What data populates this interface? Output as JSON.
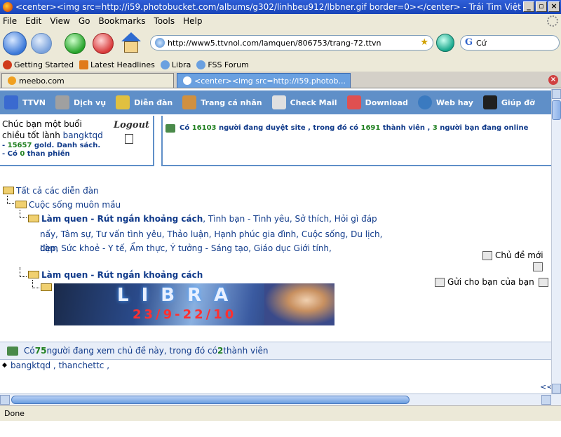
{
  "window": {
    "title": "<center><img src=http://i59.photobucket.com/albums/g302/linhbeu912/lbbner.gif border=0></center> - Trái Tim Việt Nam...",
    "buttons": [
      "_",
      "▫",
      "×"
    ]
  },
  "menu": [
    "File",
    "Edit",
    "View",
    "Go",
    "Bookmarks",
    "Tools",
    "Help"
  ],
  "navigation": {
    "url": "http://www5.ttvnol.com/lamquen/806753/trang-72.ttvn",
    "search_value": "Cứ"
  },
  "bookmarks": [
    {
      "label": "Getting Started",
      "icon": "firefox-icon",
      "color": "#d03a1a"
    },
    {
      "label": "Latest Headlines",
      "icon": "rss-icon",
      "color": "#e07a1a"
    },
    {
      "label": "Libra",
      "icon": "bulb-icon",
      "color": "#6aa0e0"
    },
    {
      "label": "FSS Forum",
      "icon": "bulb-icon",
      "color": "#6aa0e0"
    }
  ],
  "tabs": [
    {
      "label": "meebo.com",
      "active": false
    },
    {
      "label": "<center><img src=http://i59.photob...",
      "active": true
    }
  ],
  "site_nav": [
    {
      "label": "TTVN",
      "icon": "home-icon",
      "color": "#3a6ad0"
    },
    {
      "label": "Dịch vụ",
      "icon": "tools-icon",
      "color": "#a0a0a0"
    },
    {
      "label": "Diễn đàn",
      "icon": "pen-icon",
      "color": "#e0c040"
    },
    {
      "label": "Trang cá nhân",
      "icon": "people-icon",
      "color": "#d09040"
    },
    {
      "label": "Check Mail",
      "icon": "mail-icon",
      "color": "#e0e0e0"
    },
    {
      "label": "Download",
      "icon": "download-icon",
      "color": "#e05050"
    },
    {
      "label": "Web hay",
      "icon": "globe-icon",
      "color": "#3a7ac0"
    },
    {
      "label": "Giúp đỡ",
      "icon": "help-icon",
      "color": "#202020"
    }
  ],
  "user": {
    "greeting": "Chúc bạn một buổi chiều tốt lành",
    "name": "bangktqd",
    "gold_prefix": "- ",
    "gold": "15657",
    "gold_suffix": " gold. Danh sách.",
    "complaints_prefix": "- Có ",
    "complaints": "0",
    "complaints_suffix": " than phiền",
    "logout": "Logout"
  },
  "online": {
    "prefix": "Có ",
    "browsing": "16103",
    "mid1": " người đang duyệt site , trong đó có ",
    "members": "1691",
    "mid2": " thành viên , ",
    "friends": "3",
    "suffix": " người bạn đang online"
  },
  "tree": {
    "root": "Tất cả các diễn đàn",
    "level1": "Cuộc sống muôn mầu",
    "level2_title": "Làm quen - Rút ngắn khoảng cách",
    "level2_desc_line1": ", Tình bạn - Tình yêu, Sở thích, Hỏi gì đáp",
    "level2_desc_line2": "nấy, Tâm sự, Tư vấn tình yêu, Thảo luận, Hạnh phúc gia đình, Cuộc sống, Du lịch, Làm",
    "level2_desc_line3": "đẹp, Sức khoẻ - Y tế, Ẩm thực, Ý tưởng - Sáng tạo, Giáo dục Giới tính,",
    "thread_parent": "Làm quen - Rút ngắn khoảng cách"
  },
  "banner": {
    "text": "LIBRA",
    "date": "23/9-22/10"
  },
  "side_links": {
    "new_topic": "Chủ đề mới",
    "send_friend": "Gửi cho bạn của bạn"
  },
  "viewers": {
    "prefix": "Có ",
    "count": "75",
    "mid": " người đang xem chủ đề này, trong đó có ",
    "members": "2",
    "suffix": " thành viên"
  },
  "member_list": "bangktqd , thanchettc ,",
  "prev_marker": "<<",
  "status": "Done"
}
